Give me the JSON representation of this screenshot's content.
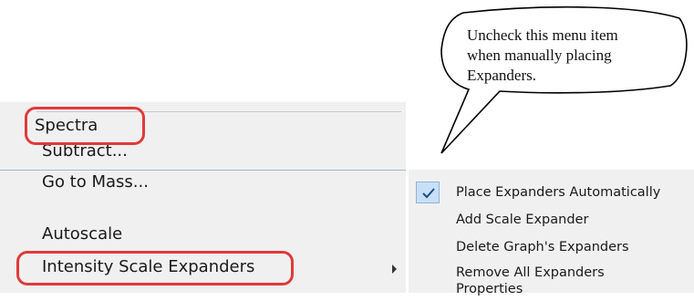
{
  "main_menu": {
    "items": [
      {
        "label": "Spectra"
      },
      {
        "label": "Subtract..."
      },
      {
        "label": "Go to Mass..."
      },
      {
        "label": "Autoscale"
      },
      {
        "label": "Intensity Scale Expanders"
      }
    ]
  },
  "submenu": {
    "items": [
      {
        "label": "Place Expanders Automatically",
        "checked": true
      },
      {
        "label": "Add Scale Expander"
      },
      {
        "label": "Delete Graph's Expanders"
      },
      {
        "label": "Remove All Expanders"
      },
      {
        "label": "Properties"
      }
    ]
  },
  "callout": {
    "line1": "Uncheck this menu item",
    "line2": "when manually placing",
    "line3": "Expanders."
  },
  "colors": {
    "highlight_ring": "#e03a3a",
    "check_background": "#c9dff7",
    "menu_background": "#f0f0f0"
  },
  "icons": {
    "checkmark": "check-icon",
    "submenu_arrow": "chevron-right-icon"
  }
}
